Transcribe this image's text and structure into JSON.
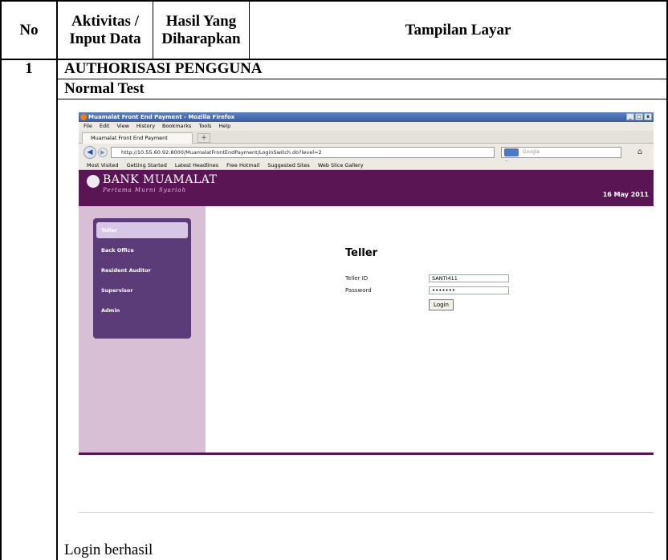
{
  "table": {
    "headers": {
      "no": "No",
      "activity": "Aktivitas / Input Data",
      "expected": "Hasil Yang Diharapkan",
      "screen": "Tampilan Layar"
    },
    "row_number": "1",
    "section_title": "AUTHORISASI PENGGUNA",
    "subsection_title": "Normal Test",
    "result_text": "Login berhasil"
  },
  "browser": {
    "window_title": "Muamalat Front End Payment - Mozilla Firefox",
    "window_buttons": [
      "_",
      "□",
      "x"
    ],
    "menu": [
      "File",
      "Edit",
      "View",
      "History",
      "Bookmarks",
      "Tools",
      "Help"
    ],
    "tab_title": "Muamalat Front End Payment",
    "new_tab": "+",
    "url": "http://10.55.60.92:8000/MuamalatFrontEndPayment/LoginSwitch.do?level=2",
    "search_placeholder": "Google",
    "bookmarks": [
      "Most Visited",
      "Getting Started",
      "Latest Headlines",
      "Free Hotmail",
      "Suggested Sites",
      "Web Slice Gallery"
    ]
  },
  "app": {
    "bank_name": "BANK MUAMALAT",
    "tagline": "Pertama Murni Syariah",
    "date": "16 May 2011",
    "sidebar": [
      "Teller",
      "Back Office",
      "Resident Auditor",
      "Supervisor",
      "Admin"
    ],
    "login_title": "Teller",
    "teller_id_label": "Teller ID",
    "teller_id_value": "SANTI411",
    "password_label": "Password",
    "password_value": "•••••••",
    "login_button": "Login"
  },
  "colors": {
    "brand_purple": "#5a1555",
    "sidebar_bg": "#d8bfd6",
    "menu_purple": "#5b3b78"
  }
}
